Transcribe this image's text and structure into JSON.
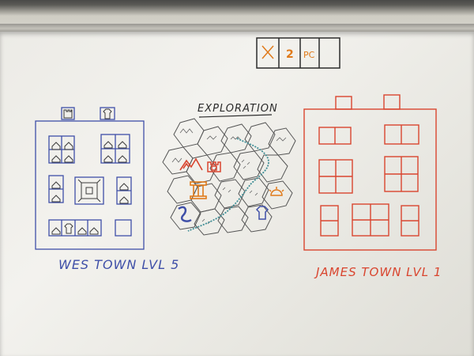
{
  "whiteboard": {
    "heading": "EXPLORATION",
    "left_town_label": "WES TOWN LVL 5",
    "right_town_label": "JAMES TOWN LVL 1",
    "top_card_number": "2",
    "top_card_code": "PC"
  },
  "ink_colors": {
    "blue": "#3f4fa8",
    "red": "#d9452f",
    "orange": "#e07a1a",
    "black": "#2b2b2b",
    "teal": "#3f8e96"
  },
  "icons": [
    "castle-icon",
    "house-icon",
    "shirt-icon",
    "mountain-icon",
    "pillar-icon",
    "river-icon",
    "sun-icon"
  ]
}
